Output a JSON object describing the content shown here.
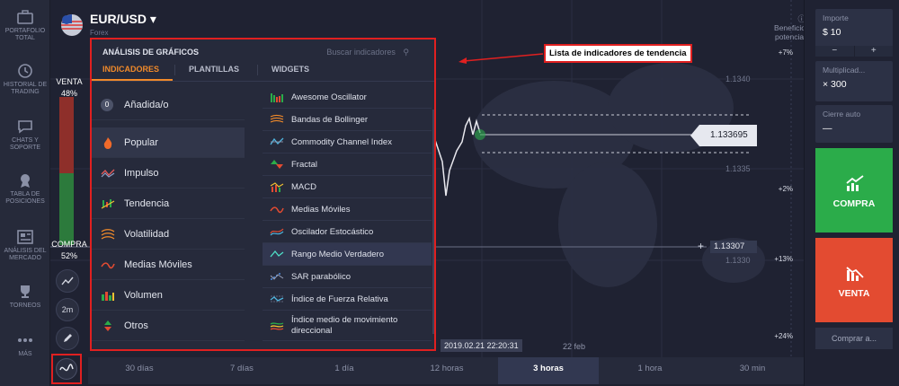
{
  "sidebar": {
    "items": [
      {
        "label": "PORTAFOLIO TOTAL",
        "icon": "briefcase-icon"
      },
      {
        "label": "HISTORIAL DE TRADING",
        "icon": "history-icon"
      },
      {
        "label": "CHATS Y SOPORTE",
        "icon": "chat-icon"
      },
      {
        "label": "TABLA DE POSICIONES",
        "icon": "trophy-ribbon-icon"
      },
      {
        "label": "ANÁLISIS DEL MERCADO",
        "icon": "newspaper-icon"
      },
      {
        "label": "TORNEOS",
        "icon": "cup-icon"
      },
      {
        "label": "MÁS",
        "icon": "more-dots-icon"
      }
    ]
  },
  "asset": {
    "pair": "EUR/USD",
    "category": "Forex"
  },
  "sentiment": {
    "sell_label": "VENTA",
    "sell_pct": "48%",
    "buy_label": "COMPRA",
    "buy_pct": "52%"
  },
  "tools": {
    "timeframe_label": "2m"
  },
  "panel": {
    "title": "ANÁLISIS DE GRÁFICOS",
    "search_placeholder": "Buscar indicadores",
    "tabs": [
      "INDICADORES",
      "PLANTILLAS",
      "WIDGETS"
    ],
    "added_count": "0",
    "categories": [
      "Añadida/o",
      "Popular",
      "Impulso",
      "Tendencia",
      "Volatilidad",
      "Medias Móviles",
      "Volumen",
      "Otros"
    ],
    "indicators": [
      "Awesome Oscillator",
      "Bandas de Bollinger",
      "Commodity Channel Index",
      "Fractal",
      "MACD",
      "Medias Móviles",
      "Oscilador Estocástico",
      "Rango Medio Verdadero",
      "SAR parabólico",
      "Índice de Fuerza Relativa",
      "Índice medio de movimiento direccional"
    ]
  },
  "annotation": "Lista de indicadores de tendencia",
  "chart": {
    "price_levels": [
      "1.1340",
      "1.1335",
      "1.1330"
    ],
    "percent_levels": [
      "+7%",
      "+2%",
      "+13%",
      "+24%"
    ],
    "current_price": "1.133695",
    "line_price": "1.13307",
    "date_box": "2019.02.21 22:20:31",
    "date_label": "22 feb"
  },
  "right": {
    "profit_label": "Beneficio potencial",
    "amount_label": "Importe",
    "amount_value": "$  10",
    "minus": "−",
    "plus": "+",
    "multiplier_label": "Multiplicad...",
    "multiplier_value": "× 300",
    "autoclose_label": "Cierre auto",
    "autoclose_value": "—",
    "buy_label": "COMPRA",
    "sell_label": "VENTA",
    "buy_at_label": "Comprar a..."
  },
  "timeframes": [
    "30 días",
    "7 días",
    "1 día",
    "12 horas",
    "3 horas",
    "1 hora",
    "30 min"
  ],
  "active_timeframe": "3 horas",
  "colors": {
    "accent": "#f18a2a",
    "buy": "#2bac4a",
    "sell": "#e34b31",
    "highlight": "#e02020"
  }
}
